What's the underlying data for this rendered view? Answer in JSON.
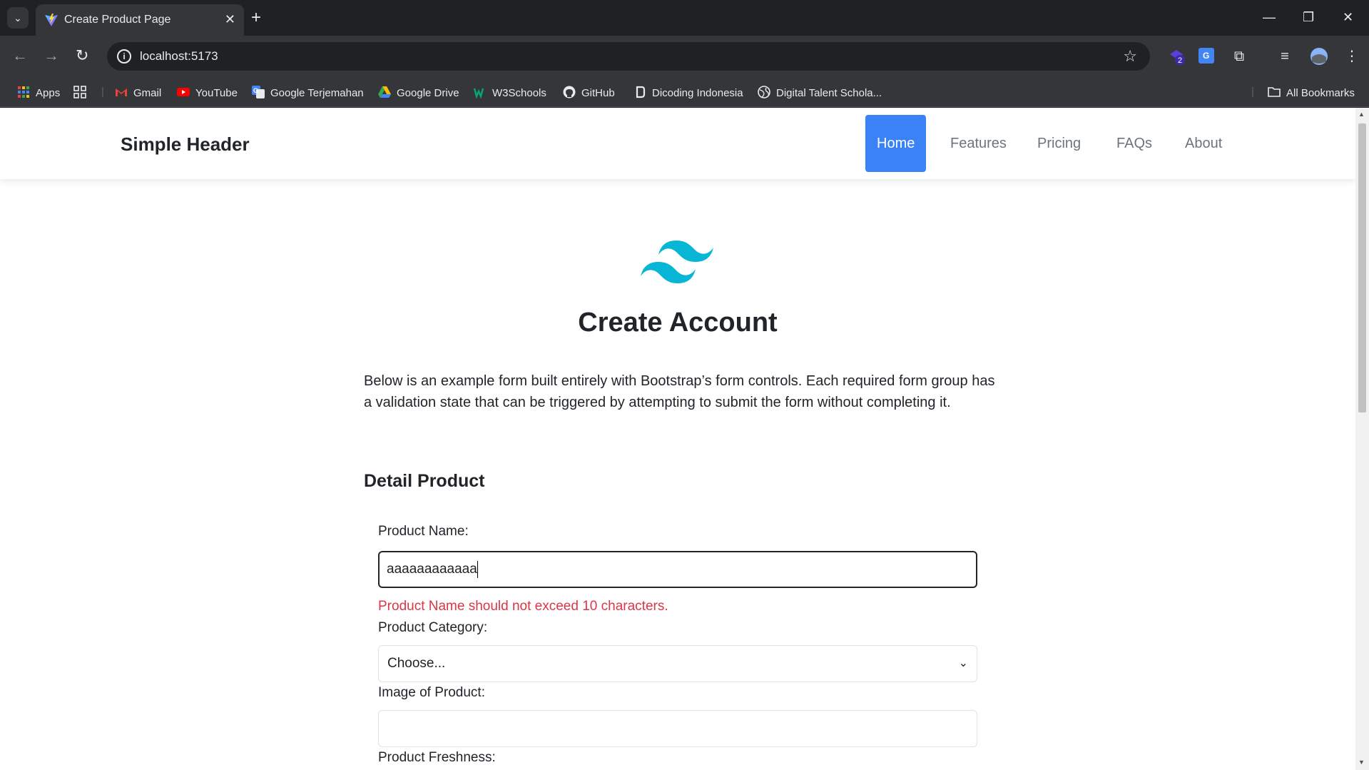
{
  "browser": {
    "tab_title": "Create Product Page",
    "url": "localhost:5173",
    "bookmarks": [
      {
        "label": "Apps",
        "icon": "apps-grid-icon"
      },
      {
        "label": "Gmail",
        "icon": "gmail-icon"
      },
      {
        "label": "YouTube",
        "icon": "youtube-icon"
      },
      {
        "label": "Google Terjemahan",
        "icon": "translate-icon"
      },
      {
        "label": "Google Drive",
        "icon": "drive-icon"
      },
      {
        "label": "W3Schools",
        "icon": "w3schools-icon"
      },
      {
        "label": "GitHub",
        "icon": "github-icon"
      },
      {
        "label": "Dicoding Indonesia",
        "icon": "dicoding-icon"
      },
      {
        "label": "Digital Talent Schola...",
        "icon": "globe-icon"
      }
    ],
    "all_bookmarks": "All Bookmarks",
    "extension_badge": "2"
  },
  "header": {
    "brand": "Simple Header",
    "nav": [
      "Home",
      "Features",
      "Pricing",
      "FAQs",
      "About"
    ],
    "active": "Home"
  },
  "main": {
    "title": "Create Account",
    "lead": "Below is an example form built entirely with Bootstrap’s form controls. Each required form group has a validation state that can be triggered by attempting to submit the form without completing it.",
    "section_title": "Detail Product",
    "product_name_label": "Product Name:",
    "product_name_value": "aaaaaaaaaaaa",
    "product_name_error": "Product Name should not exceed 10 characters.",
    "category_label": "Product Category:",
    "category_selected": "Choose...",
    "image_label": "Image of Product:",
    "freshness_label": "Product Freshness:"
  },
  "colors": {
    "accent": "#3b82f6",
    "error": "#dc3545",
    "logo": "#06b6d4"
  }
}
